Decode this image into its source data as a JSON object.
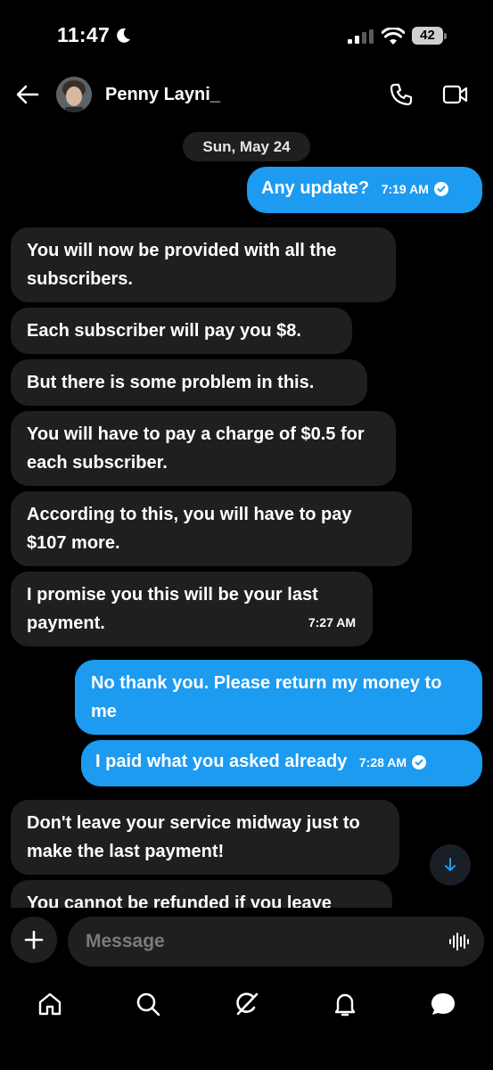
{
  "status_bar": {
    "time": "11:47",
    "battery": "42"
  },
  "header": {
    "contact_name": "Penny Layni_"
  },
  "date_separator": "Sun, May 24",
  "messages": [
    {
      "direction": "outgoing",
      "text": "Any update?",
      "time": "7:19 AM"
    },
    {
      "direction": "incoming",
      "text": "You will now be provided with all the subscribers."
    },
    {
      "direction": "incoming",
      "text": "Each subscriber will pay you $8."
    },
    {
      "direction": "incoming",
      "text": "But there is some problem in this."
    },
    {
      "direction": "incoming",
      "text": "You will have to pay a charge of $0.5 for each subscriber."
    },
    {
      "direction": "incoming",
      "text": "According to this, you will have to pay $107 more."
    },
    {
      "direction": "incoming",
      "text": "I promise you this will be your last payment.",
      "time": "7:27 AM"
    },
    {
      "direction": "outgoing",
      "text": "No thank you. Please return my money to me"
    },
    {
      "direction": "outgoing",
      "text": "I paid what you asked already",
      "time": "7:28 AM"
    },
    {
      "direction": "incoming",
      "text": "Don't leave your service midway just to make the last payment!"
    },
    {
      "direction": "incoming",
      "text": "You cannot be refunded if you leave"
    }
  ],
  "composer": {
    "placeholder": "Message"
  },
  "nav": [
    "home-icon",
    "search-icon",
    "grok-icon",
    "notifications-icon",
    "messages-icon"
  ],
  "colors": {
    "accent": "#1d9bf0",
    "incoming_bubble": "#1f1f1f",
    "background": "#000000"
  }
}
